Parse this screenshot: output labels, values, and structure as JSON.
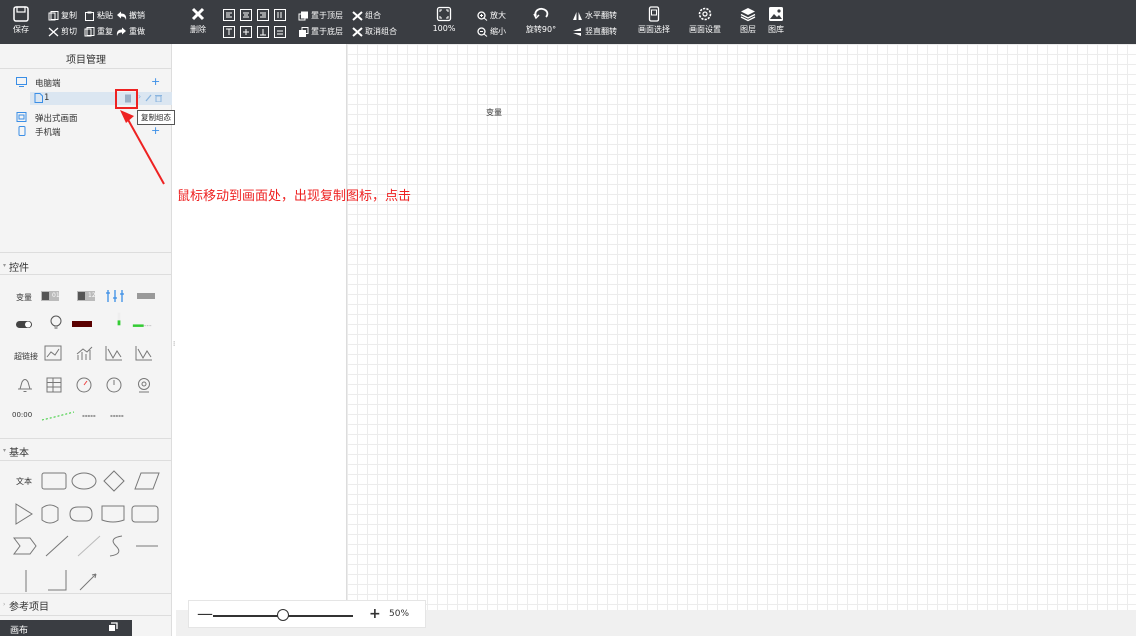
{
  "toolbar": {
    "save": "保存",
    "copy": "复制",
    "paste": "粘贴",
    "undo": "撤销",
    "cut": "剪切",
    "duplicate": "重复",
    "redo": "重做",
    "delete": "删除",
    "bring_top": "置于顶层",
    "group": "组合",
    "send_bottom": "置于底层",
    "ungroup": "取消组合",
    "zoom_fit": "100%",
    "zoom_in": "放大",
    "zoom_out": "缩小",
    "rotate": "旋转90°",
    "flip_h": "水平翻转",
    "flip_v": "竖直翻转",
    "canvas_select": "画面选择",
    "canvas_settings": "画面设置",
    "layers": "图层",
    "gallery": "图库"
  },
  "project": {
    "title": "项目管理",
    "items": [
      {
        "label": "电脑端",
        "plus": "+"
      },
      {
        "label": "1"
      },
      {
        "label": "弹出式画面"
      },
      {
        "label": "手机端",
        "plus": "+"
      }
    ],
    "tooltip": "复制组态"
  },
  "controls": {
    "title": "控件",
    "var_label": "变量",
    "badge1": "01",
    "badge2": "12",
    "hyperlink": "超链接",
    "clock": "00:00"
  },
  "basic": {
    "title": "基本",
    "text_label": "文本"
  },
  "reference": {
    "title": "参考项目"
  },
  "canvas": {
    "label": "变量",
    "tab": "画布"
  },
  "annotation": "鼠标移动到画面处，出现复制图标，点击",
  "zoom": {
    "minus": "—",
    "plus": "+",
    "value": "50%",
    "level_fraction": 0.5
  },
  "colors": {
    "toolbar_bg": "#3a3d42",
    "accent": "#3a8ee6",
    "annotation": "#e22222"
  }
}
